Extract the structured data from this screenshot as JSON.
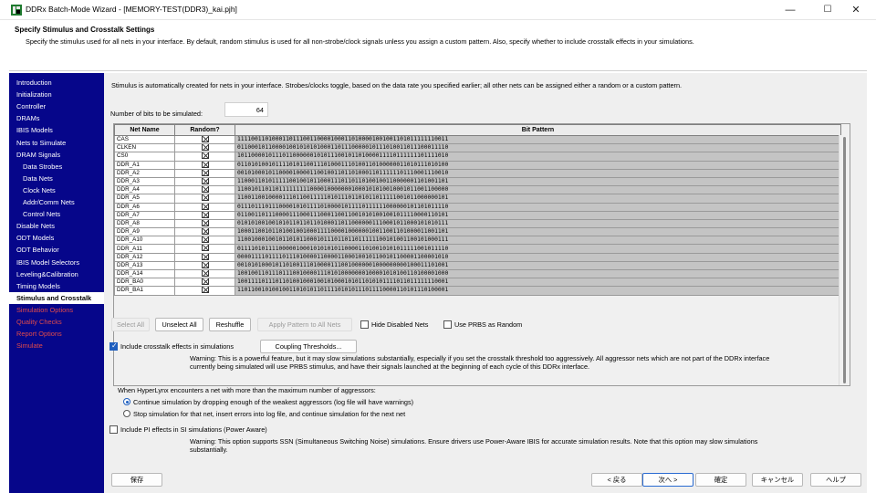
{
  "window": {
    "title": "DDRx Batch-Mode Wizard - [MEMORY-TEST(DDR3)_kai.pjh]",
    "controls": {
      "minimize": "—",
      "maximize": "☐",
      "close": "✕"
    }
  },
  "header": {
    "title": "Specify Stimulus and Crosstalk Settings",
    "description": "Specify the stimulus used for all nets in your interface.  By default, random stimulus is used for all non-strobe/clock signals unless you assign a custom pattern.  Also, specify whether to include crosstalk effects in your simulations."
  },
  "sidebar": {
    "items": [
      {
        "label": "Introduction",
        "state": "normal",
        "indent": false
      },
      {
        "label": "Initialization",
        "state": "normal",
        "indent": false
      },
      {
        "label": "Controller",
        "state": "normal",
        "indent": false
      },
      {
        "label": "DRAMs",
        "state": "normal",
        "indent": false
      },
      {
        "label": "IBIS Models",
        "state": "normal",
        "indent": false
      },
      {
        "label": "Nets to Simulate",
        "state": "normal",
        "indent": false
      },
      {
        "label": "DRAM Signals",
        "state": "normal",
        "indent": false
      },
      {
        "label": "Data Strobes",
        "state": "normal",
        "indent": true
      },
      {
        "label": "Data Nets",
        "state": "normal",
        "indent": true
      },
      {
        "label": "Clock Nets",
        "state": "normal",
        "indent": true
      },
      {
        "label": "Addr/Comm Nets",
        "state": "normal",
        "indent": true
      },
      {
        "label": "Control Nets",
        "state": "normal",
        "indent": true
      },
      {
        "label": "Disable Nets",
        "state": "normal",
        "indent": false
      },
      {
        "label": "ODT Models",
        "state": "normal",
        "indent": false
      },
      {
        "label": "ODT Behavior",
        "state": "normal",
        "indent": false
      },
      {
        "label": "IBIS Model Selectors",
        "state": "normal",
        "indent": false
      },
      {
        "label": "Leveling&Calibration",
        "state": "normal",
        "indent": false
      },
      {
        "label": "Timing Models",
        "state": "normal",
        "indent": false
      },
      {
        "label": "Stimulus and Crosstalk",
        "state": "selected",
        "indent": false
      },
      {
        "label": "Simulation Options",
        "state": "disabled",
        "indent": false
      },
      {
        "label": "Quality Checks",
        "state": "disabled",
        "indent": false
      },
      {
        "label": "Report Options",
        "state": "disabled",
        "indent": false
      },
      {
        "label": "Simulate",
        "state": "disabled",
        "indent": false
      }
    ]
  },
  "main": {
    "intro": "Stimulus is automatically created for nets in your interface.  Strobes/clocks toggle, based on the data rate you specified earlier; all other nets can be assigned either a random or a custom pattern.",
    "bits_label": "Number of bits to be simulated:",
    "bits_value": "64",
    "grid": {
      "columns": [
        "Net Name",
        "Random?",
        "Bit Pattern"
      ],
      "rows": [
        {
          "net": "CAS",
          "pattern": "1111001101000110111001100001000110100001001001101011111110011"
        },
        {
          "net": "CLKEN",
          "pattern": "0110001011000010010101010001101110000010111010011011100011110"
        },
        {
          "net": "CS0",
          "pattern": "1011000010111011000000101011100101101000011110111111101111010"
        },
        {
          "net": "DDR_A1",
          "pattern": "0110101001011110101100111010001110100110100000011010111010100"
        },
        {
          "net": "DDR_A2",
          "pattern": "0010100010110000100001100100110110100011011111101110001110010"
        },
        {
          "net": "DDR_A3",
          "pattern": "1100011010111110010010110001110110110100100110000001101001101"
        },
        {
          "net": "DDR_A4",
          "pattern": "1100101101101111111110000100000001000101010010001011001100000"
        },
        {
          "net": "DDR_A5",
          "pattern": "1100110010000111011001111101011101101011011111001011000000101"
        },
        {
          "net": "DDR_A6",
          "pattern": "0111011101110000101011110100001011110111111000000101101011110"
        },
        {
          "net": "DDR_A7",
          "pattern": "0110011011100001110001110001100110010101001001011110000110101"
        },
        {
          "net": "DDR_A8",
          "pattern": "0101010010010101101101101000110110000001110001011000101010111"
        },
        {
          "net": "DDR_A9",
          "pattern": "1000110010110100100100011110000100000010011001101000011001101"
        },
        {
          "net": "DDR_A10",
          "pattern": "1100100010010110101100010111011011011111100101001100101000111"
        },
        {
          "net": "DDR_A11",
          "pattern": "0111101011110000010001010101011000011010010101011111001011110"
        },
        {
          "net": "DDR_A12",
          "pattern": "0000111101111011101000011000011000100101100101100001100001010"
        },
        {
          "net": "DDR_A13",
          "pattern": "0010101000101101001110100001110010000001000000000100011101001"
        },
        {
          "net": "DDR_A14",
          "pattern": "1001001101110111001000011101010000000100001010100110100001000"
        },
        {
          "net": "DDR_BA0",
          "pattern": "1001111011101101001000100101000101011010101111011011111110001"
        },
        {
          "net": "DDR_BA1",
          "pattern": "1101100101001001101010110111101010111011110000110101110100001"
        }
      ]
    },
    "grid_buttons": {
      "select_all": "Select All",
      "unselect_all": "Unselect All",
      "reshuffle": "Reshuffle",
      "apply_pattern": "Apply Pattern to All Nets"
    },
    "hide_disabled": {
      "label": "Hide Disabled Nets",
      "checked": false
    },
    "use_prbs": {
      "label": "Use PRBS as Random",
      "checked": false
    },
    "crosstalk": {
      "label": "Include crosstalk effects in simulations",
      "checked": true,
      "thresholds_button": "Coupling Thresholds...",
      "warning_line1": "Warning:  This is a powerful feature, but it may slow simulations substantially, especially if you set the crosstalk threshold too aggressively.  All aggressor nets which are not part of the DDRx interface",
      "warning_line2": "currently being simulated will use PRBS stimulus, and have their signals launched at the beginning of each cycle of this DDRx interface."
    },
    "aggressors": {
      "prompt": "When HyperLynx encounters a net with more than the maximum number of aggressors:",
      "option1": "Continue simulation by dropping enough of the weakest aggressors (log file will have warnings)",
      "option2": "Stop simulation for that net, insert errors into log file, and continue simulation for the next net",
      "selected": 1
    },
    "pi_effects": {
      "label": "Include PI effects in SI simulations (Power Aware)",
      "checked": false,
      "warning_line1": "Warning:  This option supports SSN (Simultaneous Switching Noise) simulations.  Ensure drivers use Power-Aware IBIS for accurate simulation results.  Note that this option may slow simulations",
      "warning_line2": "substantially."
    },
    "footer": {
      "save": "保存",
      "back": "< 戻る",
      "next": "次へ >",
      "confirm": "確定",
      "cancel": "キャンセル",
      "help": "ヘルプ"
    }
  }
}
